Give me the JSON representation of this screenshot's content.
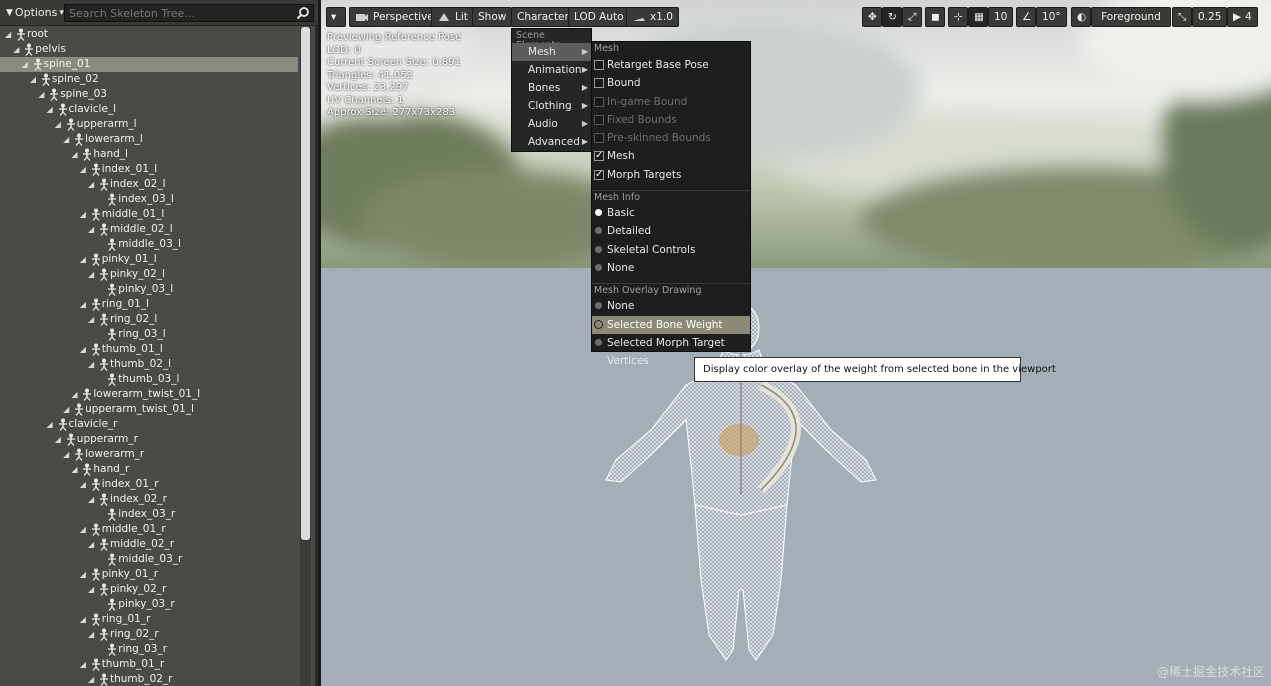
{
  "left_panel": {
    "options_label": "Options",
    "search_placeholder": "Search Skeleton Tree..."
  },
  "tree": [
    {
      "name": "root",
      "depth": 0
    },
    {
      "name": "pelvis",
      "depth": 1
    },
    {
      "name": "spine_01",
      "depth": 2,
      "selected": true
    },
    {
      "name": "spine_02",
      "depth": 3
    },
    {
      "name": "spine_03",
      "depth": 4
    },
    {
      "name": "clavicle_l",
      "depth": 5
    },
    {
      "name": "upperarm_l",
      "depth": 6
    },
    {
      "name": "lowerarm_l",
      "depth": 7
    },
    {
      "name": "hand_l",
      "depth": 8
    },
    {
      "name": "index_01_l",
      "depth": 9
    },
    {
      "name": "index_02_l",
      "depth": 10
    },
    {
      "name": "index_03_l",
      "depth": 11
    },
    {
      "name": "middle_01_l",
      "depth": 9
    },
    {
      "name": "middle_02_l",
      "depth": 10
    },
    {
      "name": "middle_03_l",
      "depth": 11
    },
    {
      "name": "pinky_01_l",
      "depth": 9
    },
    {
      "name": "pinky_02_l",
      "depth": 10
    },
    {
      "name": "pinky_03_l",
      "depth": 11
    },
    {
      "name": "ring_01_l",
      "depth": 9
    },
    {
      "name": "ring_02_l",
      "depth": 10
    },
    {
      "name": "ring_03_l",
      "depth": 11
    },
    {
      "name": "thumb_01_l",
      "depth": 9
    },
    {
      "name": "thumb_02_l",
      "depth": 10
    },
    {
      "name": "thumb_03_l",
      "depth": 11
    },
    {
      "name": "lowerarm_twist_01_l",
      "depth": 8
    },
    {
      "name": "upperarm_twist_01_l",
      "depth": 7
    },
    {
      "name": "clavicle_r",
      "depth": 5
    },
    {
      "name": "upperarm_r",
      "depth": 6
    },
    {
      "name": "lowerarm_r",
      "depth": 7
    },
    {
      "name": "hand_r",
      "depth": 8
    },
    {
      "name": "index_01_r",
      "depth": 9
    },
    {
      "name": "index_02_r",
      "depth": 10
    },
    {
      "name": "index_03_r",
      "depth": 11
    },
    {
      "name": "middle_01_r",
      "depth": 9
    },
    {
      "name": "middle_02_r",
      "depth": 10
    },
    {
      "name": "middle_03_r",
      "depth": 11
    },
    {
      "name": "pinky_01_r",
      "depth": 9
    },
    {
      "name": "pinky_02_r",
      "depth": 10
    },
    {
      "name": "pinky_03_r",
      "depth": 11
    },
    {
      "name": "ring_01_r",
      "depth": 9
    },
    {
      "name": "ring_02_r",
      "depth": 10
    },
    {
      "name": "ring_03_r",
      "depth": 11
    },
    {
      "name": "thumb_01_r",
      "depth": 9
    },
    {
      "name": "thumb_02_r",
      "depth": 10
    }
  ],
  "toolbar": {
    "perspective": "Perspective",
    "lit": "Lit",
    "show": "Show",
    "character": "Character",
    "lod": "LOD Auto",
    "speed": "x1.0",
    "grid_snap": "10",
    "rot_snap": "10°",
    "layer": "Foreground",
    "scale_snap": "0.25",
    "cam_speed": "4"
  },
  "stats": [
    "Previewing Reference Pose",
    "LOD: 0",
    "Current Screen Size: 0.891",
    "Triangles: 41,052",
    "Vertices: 23,297",
    "UV Channels: 1",
    "Approx Size: 277x73x283"
  ],
  "menu": {
    "header": "Scene Elements",
    "items": [
      {
        "label": "Mesh",
        "active": true
      },
      {
        "label": "Animation"
      },
      {
        "label": "Bones"
      },
      {
        "label": "Clothing"
      },
      {
        "label": "Audio"
      },
      {
        "label": "Advanced"
      }
    ]
  },
  "submenu": {
    "mesh_header": "Mesh",
    "mesh_items": [
      {
        "label": "Retarget Base Pose",
        "checked": false,
        "disabled": false
      },
      {
        "label": "Bound",
        "checked": false,
        "disabled": false
      },
      {
        "label": "In-game Bound",
        "checked": false,
        "disabled": true
      },
      {
        "label": "Fixed Bounds",
        "checked": false,
        "disabled": true
      },
      {
        "label": "Pre-skinned Bounds",
        "checked": false,
        "disabled": true
      },
      {
        "label": "Mesh",
        "checked": true,
        "disabled": false
      },
      {
        "label": "Morph Targets",
        "checked": true,
        "disabled": false
      }
    ],
    "info_header": "Mesh Info",
    "info_items": [
      {
        "label": "Basic",
        "on": true
      },
      {
        "label": "Detailed",
        "on": false
      },
      {
        "label": "Skeletal Controls",
        "on": false
      },
      {
        "label": "None",
        "on": false
      }
    ],
    "overlay_header": "Mesh Overlay Drawing",
    "overlay_items": [
      {
        "label": "None",
        "on": false
      },
      {
        "label": "Selected Bone Weight",
        "on": false,
        "highlight": true
      },
      {
        "label": "Selected Morph Target Vertices",
        "on": false
      }
    ]
  },
  "tooltip": "Display color overlay of the weight from selected bone in the viewport",
  "watermark": "@稀土掘金技术社区"
}
